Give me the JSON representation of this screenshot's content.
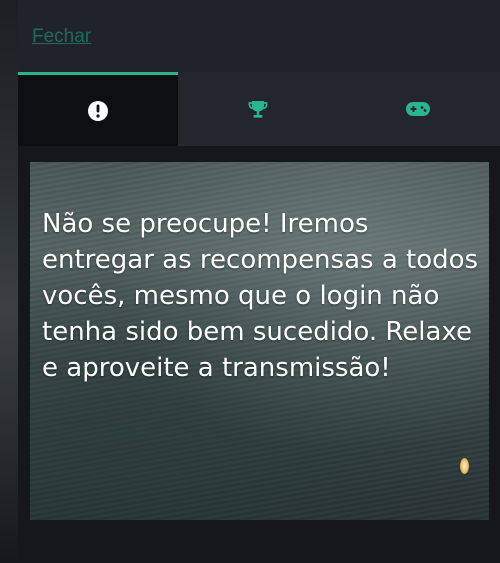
{
  "header": {
    "close_label": "Fechar"
  },
  "tabs": [
    {
      "id": "info",
      "icon": "exclamation-circle-icon",
      "active": true,
      "color": "#ffffff"
    },
    {
      "id": "rewards",
      "icon": "trophy-icon",
      "active": false,
      "color": "#2bb58f"
    },
    {
      "id": "games",
      "icon": "gamepad-icon",
      "active": false,
      "color": "#2bb58f"
    }
  ],
  "message": {
    "text": "Não se preocupe! Iremos entregar as recompensas a todos vocês, mesmo que o login não tenha sido bem sucedido. Relaxe e aproveite a transmissão!"
  },
  "colors": {
    "accent": "#2bb58f",
    "link": "#1f6b5a",
    "panel": "#1c1f24"
  }
}
